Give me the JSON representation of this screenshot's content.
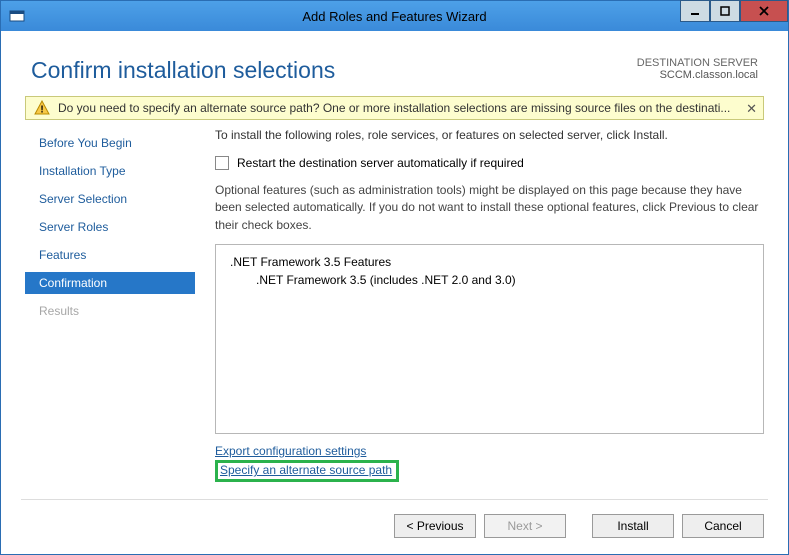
{
  "window": {
    "title": "Add Roles and Features Wizard"
  },
  "header": {
    "page_title": "Confirm installation selections",
    "destination_label": "DESTINATION SERVER",
    "destination_value": "SCCM.classon.local"
  },
  "alert": {
    "text": "Do you need to specify an alternate source path? One or more installation selections are missing source files on the destinati...",
    "close": "✕"
  },
  "sidebar": {
    "items": [
      {
        "label": "Before You Begin",
        "state": "normal"
      },
      {
        "label": "Installation Type",
        "state": "normal"
      },
      {
        "label": "Server Selection",
        "state": "normal"
      },
      {
        "label": "Server Roles",
        "state": "normal"
      },
      {
        "label": "Features",
        "state": "normal"
      },
      {
        "label": "Confirmation",
        "state": "active"
      },
      {
        "label": "Results",
        "state": "disabled"
      }
    ]
  },
  "main": {
    "instruction": "To install the following roles, role services, or features on selected server, click Install.",
    "restart_checkbox_label": "Restart the destination server automatically if required",
    "restart_checked": false,
    "optional_text": "Optional features (such as administration tools) might be displayed on this page because they have been selected automatically. If you do not want to install these optional features, click Previous to clear their check boxes.",
    "features_list": [
      {
        "label": ".NET Framework 3.5 Features",
        "indent": 0
      },
      {
        "label": ".NET Framework 3.5 (includes .NET 2.0 and 3.0)",
        "indent": 1
      }
    ],
    "export_link": "Export configuration settings",
    "alt_source_link": "Specify an alternate source path"
  },
  "footer": {
    "previous": "< Previous",
    "next": "Next >",
    "install": "Install",
    "cancel": "Cancel"
  }
}
